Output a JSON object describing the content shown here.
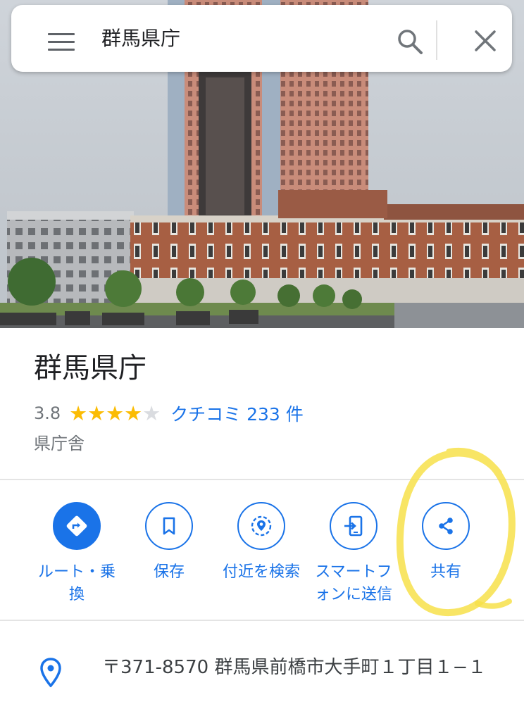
{
  "search": {
    "query": "群馬県庁"
  },
  "place": {
    "title": "群馬県庁",
    "rating": "3.8",
    "stars": 3.8,
    "reviews_label": "クチコミ 233 件",
    "category": "県庁舎"
  },
  "actions": [
    {
      "label": "ルート・乗換",
      "icon": "directions-icon"
    },
    {
      "label": "保存",
      "icon": "bookmark-icon"
    },
    {
      "label": "付近を検索",
      "icon": "nearby-icon"
    },
    {
      "label": "スマートフォンに送信",
      "icon": "send-to-phone-icon"
    },
    {
      "label": "共有",
      "icon": "share-icon"
    }
  ],
  "address": "〒371-8570 群馬県前橋市大手町１丁目１−１",
  "colors": {
    "accent": "#1a73e8",
    "star": "#fbbc04",
    "star_empty": "#dadce0",
    "highlight": "#f7e04a"
  }
}
